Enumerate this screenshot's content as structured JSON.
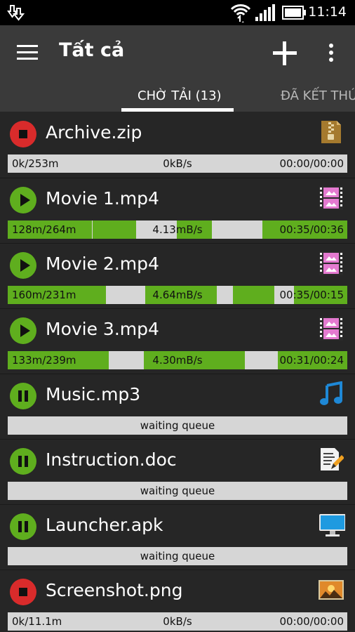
{
  "status": {
    "time": "11:14"
  },
  "appbar": {
    "title": "Tất cả"
  },
  "tabs": [
    {
      "label": "CHỜ TẢI (13)",
      "active": true
    },
    {
      "label": "ĐÃ KẾT THÚ",
      "active": false
    }
  ],
  "colors": {
    "accent": "#5fae1e",
    "stop": "#d92b2b",
    "bar_bg": "#d6d6d6",
    "appbar": "#3a3a3a"
  },
  "downloads": [
    {
      "name": "Archive.zip",
      "state": "stop-icon",
      "icon": "zip-archive-icon",
      "size": "0k/253m",
      "speed": "0kB/s",
      "time": "00:00/00:00"
    },
    {
      "name": "Movie 1.mp4",
      "state": "play-icon",
      "icon": "video-file-icon",
      "size": "128m/264m",
      "speed": "4.13mB/s",
      "time": "00:35/00:36"
    },
    {
      "name": "Movie 2.mp4",
      "state": "play-icon",
      "icon": "video-file-icon",
      "size": "160m/231m",
      "speed": "4.64mB/s",
      "time": "00:35/00:15"
    },
    {
      "name": "Movie 3.mp4",
      "state": "play-icon",
      "icon": "video-file-icon",
      "size": "133m/239m",
      "speed": "4.30mB/s",
      "time": "00:31/00:24"
    },
    {
      "name": "Music.mp3",
      "state": "pause-icon",
      "icon": "music-note-icon",
      "queue": "waiting queue"
    },
    {
      "name": "Instruction.doc",
      "state": "pause-icon",
      "icon": "document-edit-icon",
      "queue": "waiting queue"
    },
    {
      "name": "Launcher.apk",
      "state": "pause-icon",
      "icon": "monitor-icon",
      "queue": "waiting queue"
    },
    {
      "name": "Screenshot.png",
      "state": "stop-icon",
      "icon": "image-file-icon",
      "size": "0k/11.1m",
      "speed": "0kB/s",
      "time": "00:00/00:00"
    }
  ]
}
